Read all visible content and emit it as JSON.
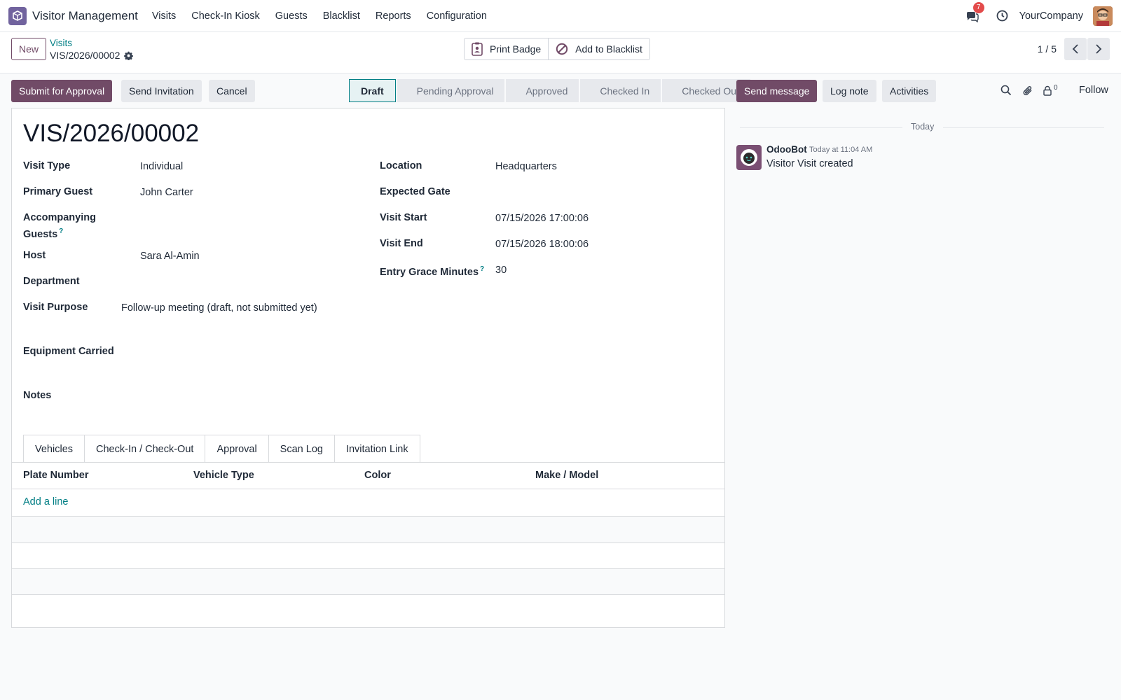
{
  "navbar": {
    "app_name": "Visitor Management",
    "menu": [
      "Visits",
      "Check-In Kiosk",
      "Guests",
      "Blacklist",
      "Reports",
      "Configuration"
    ],
    "message_count": "7",
    "company": "YourCompany"
  },
  "control": {
    "new_label": "New",
    "breadcrumb_parent": "Visits",
    "breadcrumb_current": "VIS/2026/00002",
    "print_badge": "Print Badge",
    "add_blacklist": "Add to Blacklist",
    "pager": "1 / 5"
  },
  "status_row": {
    "submit": "Submit for Approval",
    "send_invitation": "Send Invitation",
    "cancel": "Cancel",
    "stages": [
      "Draft",
      "Pending Approval",
      "Approved",
      "Checked In",
      "Checked Out"
    ],
    "active_stage": "Draft"
  },
  "form": {
    "title": "VIS/2026/00002",
    "visit_type_label": "Visit Type",
    "visit_type": "Individual",
    "primary_guest_label": "Primary Guest",
    "primary_guest": "John Carter",
    "accompanying_label_1": "Accompanying",
    "accompanying_label_2": "Guests",
    "host_label": "Host",
    "host": "Sara Al-Amin",
    "department_label": "Department",
    "purpose_label": "Visit Purpose",
    "purpose": "Follow-up meeting (draft, not submitted yet)",
    "equipment_label": "Equipment Carried",
    "notes_label": "Notes",
    "location_label": "Location",
    "location": "Headquarters",
    "gate_label": "Expected Gate",
    "visit_start_label": "Visit Start",
    "visit_start": "07/15/2026 17:00:06",
    "visit_end_label": "Visit End",
    "visit_end": "07/15/2026 18:00:06",
    "grace_label": "Entry Grace Minutes",
    "grace": "30",
    "help_mark": "?"
  },
  "tabs": [
    "Vehicles",
    "Check-In / Check-Out",
    "Approval",
    "Scan Log",
    "Invitation Link"
  ],
  "vehicles": {
    "columns": [
      "Plate Number",
      "Vehicle Type",
      "Color",
      "Make / Model"
    ],
    "add_line": "Add a line"
  },
  "chatter": {
    "send_message": "Send message",
    "log_note": "Log note",
    "activities": "Activities",
    "follower_count": "0",
    "follow": "Follow",
    "date_separator": "Today",
    "message": {
      "author": "OdooBot",
      "time": "Today at 11:04 AM",
      "body": "Visitor Visit created"
    }
  },
  "colors": {
    "primary": "#714b67",
    "link": "#017e84",
    "badge": "#e34b4b"
  }
}
